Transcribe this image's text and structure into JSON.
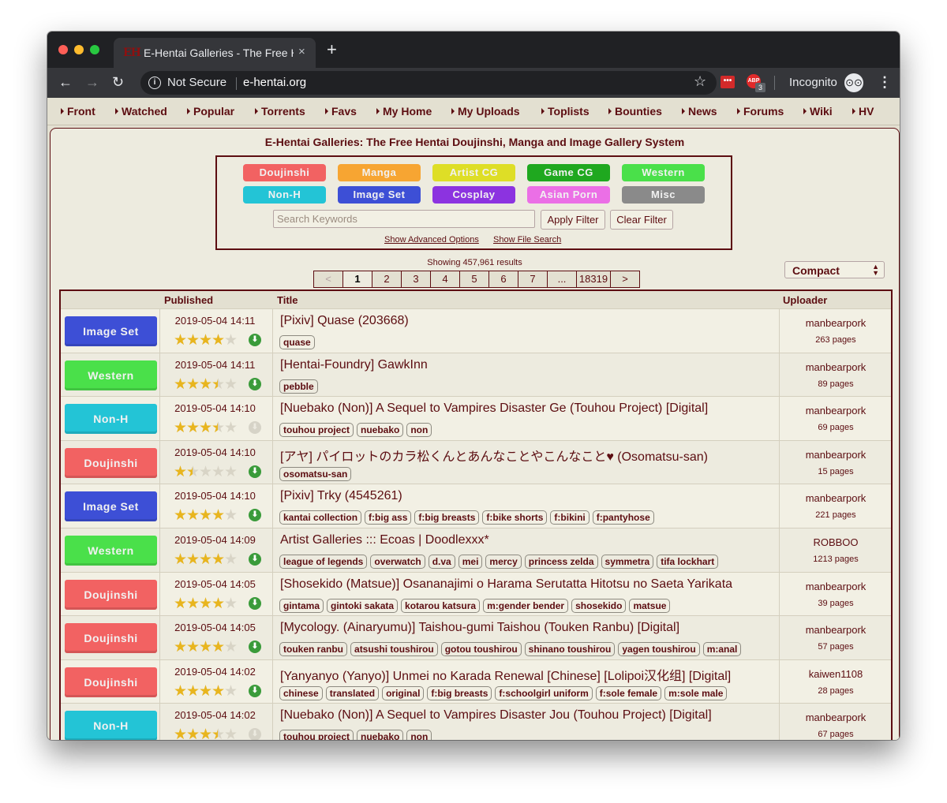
{
  "browser": {
    "tab_favicon": "EH",
    "tab_title": "E-Hentai Galleries - The Free Hentai",
    "tab_close": "×",
    "new_tab": "+",
    "back": "←",
    "forward": "→",
    "reload": "↻",
    "info_icon": "i",
    "not_secure": "Not Secure",
    "url": "e-hentai.org",
    "star": "☆",
    "ext1": "•••",
    "ext2": "ABP",
    "ext2_badge": "3",
    "incognito_label": "Incognito",
    "incognito_icon": "⊙⊙",
    "menu": "⋮"
  },
  "nav": [
    "Front",
    "Watched",
    "Popular",
    "Torrents",
    "Favs",
    "My Home",
    "My Uploads",
    "Toplists",
    "Bounties",
    "News",
    "Forums",
    "Wiki",
    "HV"
  ],
  "site_title": "E-Hentai Galleries: The Free Hentai Doujinshi, Manga and Image Gallery System",
  "categories": [
    {
      "label": "Doujinshi",
      "color": "#f26262"
    },
    {
      "label": "Manga",
      "color": "#f7a532"
    },
    {
      "label": "Artist CG",
      "color": "#dede26"
    },
    {
      "label": "Game CG",
      "color": "#1fa81f"
    },
    {
      "label": "Western",
      "color": "#4ae04a"
    },
    {
      "label": "Non-H",
      "color": "#23c4d6"
    },
    {
      "label": "Image Set",
      "color": "#3d4fd6"
    },
    {
      "label": "Cosplay",
      "color": "#8c33e0"
    },
    {
      "label": "Asian Porn",
      "color": "#eb6fe6"
    },
    {
      "label": "Misc",
      "color": "#8a8a8a"
    }
  ],
  "search": {
    "placeholder": "Search Keywords",
    "apply": "Apply Filter",
    "clear": "Clear Filter",
    "advanced": "Show Advanced Options",
    "file_search": "Show File Search"
  },
  "showing": "Showing 457,961 results",
  "pager": [
    "<",
    "1",
    "2",
    "3",
    "4",
    "5",
    "6",
    "7",
    "...",
    "18319",
    ">"
  ],
  "view_mode": {
    "label": "Compact",
    "arrow": "▲▼"
  },
  "table": {
    "headers": {
      "published": "Published",
      "title": "Title",
      "uploader": "Uploader"
    },
    "rows": [
      {
        "category": "Image Set",
        "color": "#3d4fd6",
        "date": "2019-05-04 14:11",
        "rating": 4,
        "torrent": true,
        "title": "[Pixiv] Quase (203668)",
        "tags": [
          "quase"
        ],
        "uploader": "manbearpork",
        "pages": "263 pages"
      },
      {
        "category": "Western",
        "color": "#4ae04a",
        "date": "2019-05-04 14:11",
        "rating": 3.5,
        "torrent": true,
        "title": "[Hentai-Foundry] GawkInn",
        "tags": [
          "pebble"
        ],
        "uploader": "manbearpork",
        "pages": "89 pages"
      },
      {
        "category": "Non-H",
        "color": "#23c4d6",
        "date": "2019-05-04 14:10",
        "rating": 3.5,
        "torrent": false,
        "title": "[Nuebako (Non)] A Sequel to Vampires Disaster Ge (Touhou Project) [Digital]",
        "tags": [
          "touhou project",
          "nuebako",
          "non"
        ],
        "uploader": "manbearpork",
        "pages": "69 pages"
      },
      {
        "category": "Doujinshi",
        "color": "#f26262",
        "date": "2019-05-04 14:10",
        "rating": 1.5,
        "torrent": true,
        "title": "[アヤ] パイロットのカラ松くんとあんなことやこんなこと♥ (Osomatsu-san)",
        "tags": [
          "osomatsu-san"
        ],
        "uploader": "manbearpork",
        "pages": "15 pages"
      },
      {
        "category": "Image Set",
        "color": "#3d4fd6",
        "date": "2019-05-04 14:10",
        "rating": 4,
        "torrent": true,
        "title": "[Pixiv] Trky (4545261)",
        "tags": [
          "kantai collection",
          "f:big ass",
          "f:big breasts",
          "f:bike shorts",
          "f:bikini",
          "f:pantyhose"
        ],
        "uploader": "manbearpork",
        "pages": "221 pages"
      },
      {
        "category": "Western",
        "color": "#4ae04a",
        "date": "2019-05-04 14:09",
        "rating": 4,
        "torrent": true,
        "title": "Artist Galleries ::: Ecoas | Doodlexxx*",
        "tags": [
          "league of legends",
          "overwatch",
          "d.va",
          "mei",
          "mercy",
          "princess zelda",
          "symmetra",
          "tifa lockhart"
        ],
        "uploader": "ROBBOO",
        "pages": "1213 pages"
      },
      {
        "category": "Doujinshi",
        "color": "#f26262",
        "date": "2019-05-04 14:05",
        "rating": 4,
        "torrent": true,
        "title": "[Shosekido (Matsue)] Osananajimi o Harama Serutatta Hitotsu no Saeta Yarikata",
        "tags": [
          "gintama",
          "gintoki sakata",
          "kotarou katsura",
          "m:gender bender",
          "shosekido",
          "matsue"
        ],
        "uploader": "manbearpork",
        "pages": "39 pages"
      },
      {
        "category": "Doujinshi",
        "color": "#f26262",
        "date": "2019-05-04 14:05",
        "rating": 4,
        "torrent": true,
        "title": "[Mycology. (Ainaryumu)] Taishou-gumi Taishou (Touken Ranbu) [Digital]",
        "tags": [
          "touken ranbu",
          "atsushi toushirou",
          "gotou toushirou",
          "shinano toushirou",
          "yagen toushirou",
          "m:anal"
        ],
        "uploader": "manbearpork",
        "pages": "57 pages"
      },
      {
        "category": "Doujinshi",
        "color": "#f26262",
        "date": "2019-05-04 14:02",
        "rating": 4,
        "torrent": true,
        "title": "[Yanyanyo (Yanyo)] Unmei no Karada Renewal [Chinese] [Lolipoi汉化组] [Digital]",
        "tags": [
          "chinese",
          "translated",
          "original",
          "f:big breasts",
          "f:schoolgirl uniform",
          "f:sole female",
          "m:sole male"
        ],
        "uploader": "kaiwen1108",
        "pages": "28 pages"
      },
      {
        "category": "Non-H",
        "color": "#23c4d6",
        "date": "2019-05-04 14:02",
        "rating": 3.5,
        "torrent": false,
        "title": "[Nuebako (Non)] A Sequel to Vampires Disaster Jou (Touhou Project) [Digital]",
        "tags": [
          "touhou project",
          "nuebako",
          "non"
        ],
        "uploader": "manbearpork",
        "pages": "67 pages"
      }
    ]
  }
}
